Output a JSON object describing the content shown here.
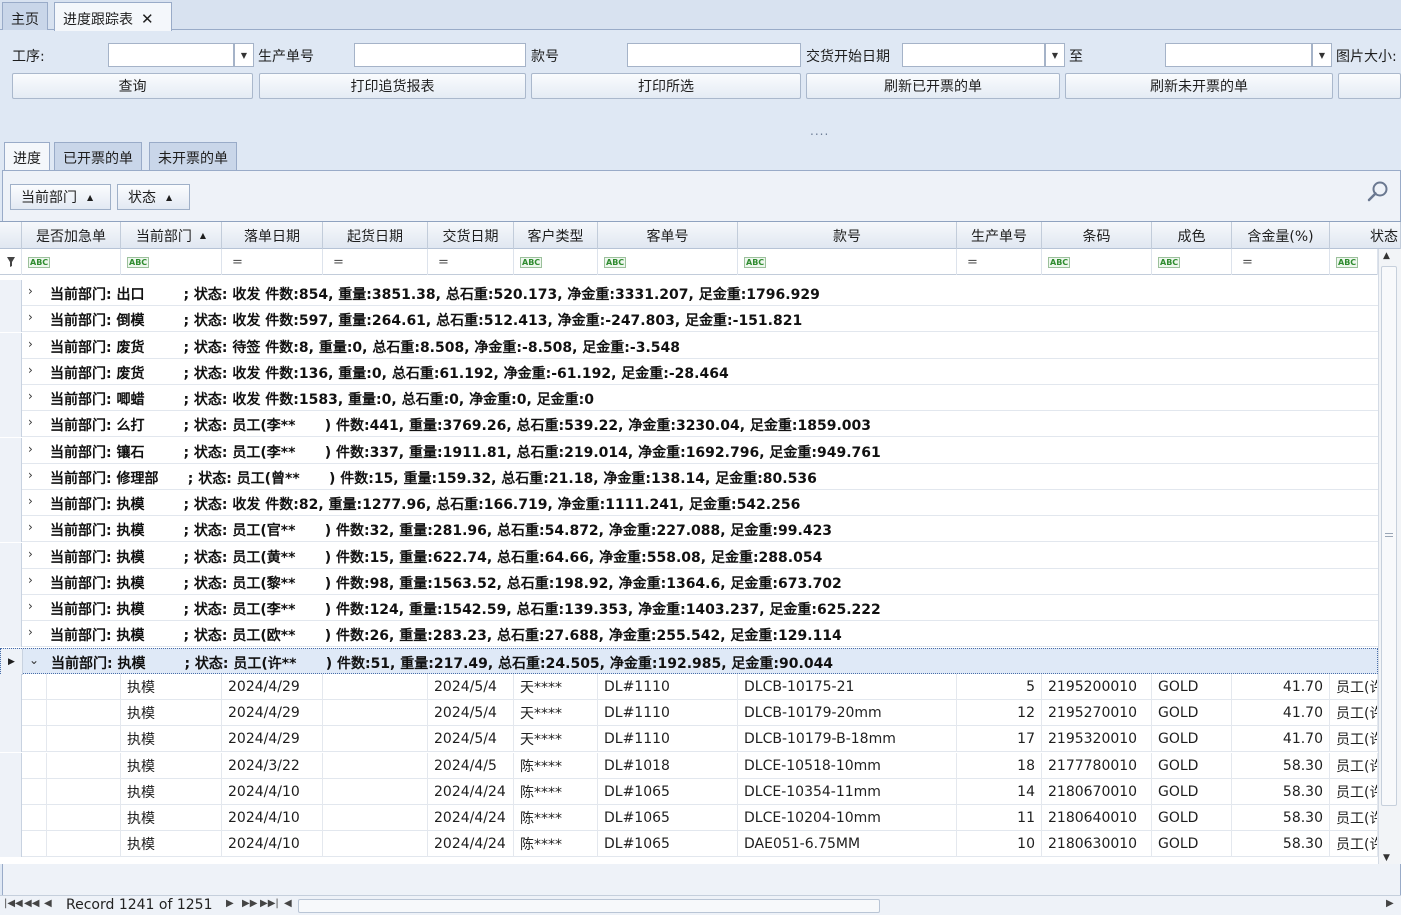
{
  "tabs": [
    {
      "label": "主页",
      "active": false
    },
    {
      "label": "进度跟踪表",
      "active": true,
      "close": "✕"
    }
  ],
  "filters": {
    "process_label": "工序:",
    "process_value": "",
    "production_no_label": "生产单号",
    "production_no_value": "",
    "style_no_label": "款号",
    "style_no_value": "",
    "delivery_start_label": "交货开始日期",
    "delivery_start_value": "",
    "to_label": "至",
    "delivery_end_value": "",
    "image_size_label": "图片大小:"
  },
  "buttons": {
    "query": "查询",
    "print_report": "打印追货报表",
    "print_selected": "打印所选",
    "refresh_invoiced": "刷新已开票的单",
    "refresh_uninvoiced": "刷新未开票的单"
  },
  "splitter": "....",
  "inner_tabs": [
    {
      "label": "进度",
      "active": true
    },
    {
      "label": "已开票的单",
      "active": false
    },
    {
      "label": "未开票的单",
      "active": false
    }
  ],
  "group_chips": [
    "当前部门",
    "状态"
  ],
  "columns": [
    "是否加急单",
    "当前部门",
    "落单日期",
    "起货日期",
    "交货日期",
    "客户类型",
    "客单号",
    "款号",
    "生产单号",
    "条码",
    "成色",
    "含金量(%)",
    "状态"
  ],
  "group_rows": [
    {
      "text": "当前部门: 出口        ; 状态: 收发 件数:854, 重量:3851.38, 总石重:520.173, 净金重:3331.207, 足金重:1796.929",
      "expanded": false
    },
    {
      "text": "当前部门: 倒模        ; 状态: 收发 件数:597, 重量:264.61, 总石重:512.413, 净金重:-247.803, 足金重:-151.821",
      "expanded": false
    },
    {
      "text": "当前部门: 废货        ; 状态: 待签 件数:8, 重量:0, 总石重:8.508, 净金重:-8.508, 足金重:-3.548",
      "expanded": false
    },
    {
      "text": "当前部门: 废货        ; 状态: 收发 件数:136, 重量:0, 总石重:61.192, 净金重:-61.192, 足金重:-28.464",
      "expanded": false
    },
    {
      "text": "当前部门: 唧蜡        ; 状态: 收发 件数:1583, 重量:0, 总石重:0, 净金重:0, 足金重:0",
      "expanded": false
    },
    {
      "text": "当前部门: 么打        ; 状态: 员工(李**      ) 件数:441, 重量:3769.26, 总石重:539.22, 净金重:3230.04, 足金重:1859.003",
      "expanded": false
    },
    {
      "text": "当前部门: 镶石        ; 状态: 员工(李**      ) 件数:337, 重量:1911.81, 总石重:219.014, 净金重:1692.796, 足金重:949.761",
      "expanded": false
    },
    {
      "text": "当前部门: 修理部      ; 状态: 员工(曾**      ) 件数:15, 重量:159.32, 总石重:21.18, 净金重:138.14, 足金重:80.536",
      "expanded": false
    },
    {
      "text": "当前部门: 执模        ; 状态: 收发 件数:82, 重量:1277.96, 总石重:166.719, 净金重:1111.241, 足金重:542.256",
      "expanded": false
    },
    {
      "text": "当前部门: 执模        ; 状态: 员工(官**      ) 件数:32, 重量:281.96, 总石重:54.872, 净金重:227.088, 足金重:99.423",
      "expanded": false
    },
    {
      "text": "当前部门: 执模        ; 状态: 员工(黄**      ) 件数:15, 重量:622.74, 总石重:64.66, 净金重:558.08, 足金重:288.054",
      "expanded": false
    },
    {
      "text": "当前部门: 执模        ; 状态: 员工(黎**      ) 件数:98, 重量:1563.52, 总石重:198.92, 净金重:1364.6, 足金重:673.702",
      "expanded": false
    },
    {
      "text": "当前部门: 执模        ; 状态: 员工(李**      ) 件数:124, 重量:1542.59, 总石重:139.353, 净金重:1403.237, 足金重:625.222",
      "expanded": false
    },
    {
      "text": "当前部门: 执模        ; 状态: 员工(欧**      ) 件数:26, 重量:283.23, 总石重:27.688, 净金重:255.542, 足金重:129.114",
      "expanded": false
    },
    {
      "text": "当前部门: 执模        ; 状态: 员工(许**      ) 件数:51, 重量:217.49, 总石重:24.505, 净金重:192.985, 足金重:90.044",
      "expanded": true
    }
  ],
  "data_rows": [
    {
      "dept": "执模",
      "order_date": "2024/4/29",
      "ship_date": "",
      "delivery_date": "2024/5/4",
      "customer_type": "天****",
      "customer_order": "DL#1110",
      "style": "DLCB-10175-21",
      "prod_no": "5",
      "barcode": "2195200010",
      "purity": "GOLD",
      "gold_pct": "41.70",
      "status": "员工(许"
    },
    {
      "dept": "执模",
      "order_date": "2024/4/29",
      "ship_date": "",
      "delivery_date": "2024/5/4",
      "customer_type": "天****",
      "customer_order": "DL#1110",
      "style": "DLCB-10179-20mm",
      "prod_no": "12",
      "barcode": "2195270010",
      "purity": "GOLD",
      "gold_pct": "41.70",
      "status": "员工(许"
    },
    {
      "dept": "执模",
      "order_date": "2024/4/29",
      "ship_date": "",
      "delivery_date": "2024/5/4",
      "customer_type": "天****",
      "customer_order": "DL#1110",
      "style": "DLCB-10179-B-18mm",
      "prod_no": "17",
      "barcode": "2195320010",
      "purity": "GOLD",
      "gold_pct": "41.70",
      "status": "员工(许"
    },
    {
      "dept": "执模",
      "order_date": "2024/3/22",
      "ship_date": "",
      "delivery_date": "2024/4/5",
      "customer_type": "陈****",
      "customer_order": "DL#1018",
      "style": "DLCE-10518-10mm",
      "prod_no": "18",
      "barcode": "2177780010",
      "purity": "GOLD",
      "gold_pct": "58.30",
      "status": "员工(许"
    },
    {
      "dept": "执模",
      "order_date": "2024/4/10",
      "ship_date": "",
      "delivery_date": "2024/4/24",
      "customer_type": "陈****",
      "customer_order": "DL#1065",
      "style": "DLCE-10354-11mm",
      "prod_no": "14",
      "barcode": "2180670010",
      "purity": "GOLD",
      "gold_pct": "58.30",
      "status": "员工(许"
    },
    {
      "dept": "执模",
      "order_date": "2024/4/10",
      "ship_date": "",
      "delivery_date": "2024/4/24",
      "customer_type": "陈****",
      "customer_order": "DL#1065",
      "style": "DLCE-10204-10mm",
      "prod_no": "11",
      "barcode": "2180640010",
      "purity": "GOLD",
      "gold_pct": "58.30",
      "status": "员工(许"
    },
    {
      "dept": "执模",
      "order_date": "2024/4/10",
      "ship_date": "",
      "delivery_date": "2024/4/24",
      "customer_type": "陈****",
      "customer_order": "DL#1065",
      "style": "DAE051-6.75MM",
      "prod_no": "10",
      "barcode": "2180630010",
      "purity": "GOLD",
      "gold_pct": "58.30",
      "status": "员工(许"
    }
  ],
  "footer": {
    "record_info": "Record 1241 of 1251"
  },
  "icons": {
    "close": "close-icon",
    "search": "search-icon",
    "filter": "filter-icon"
  },
  "colors": {
    "window_bg": "#dfe8f4",
    "selected_row": "#dfe9f7",
    "header_bg": "#e0e7f1"
  }
}
